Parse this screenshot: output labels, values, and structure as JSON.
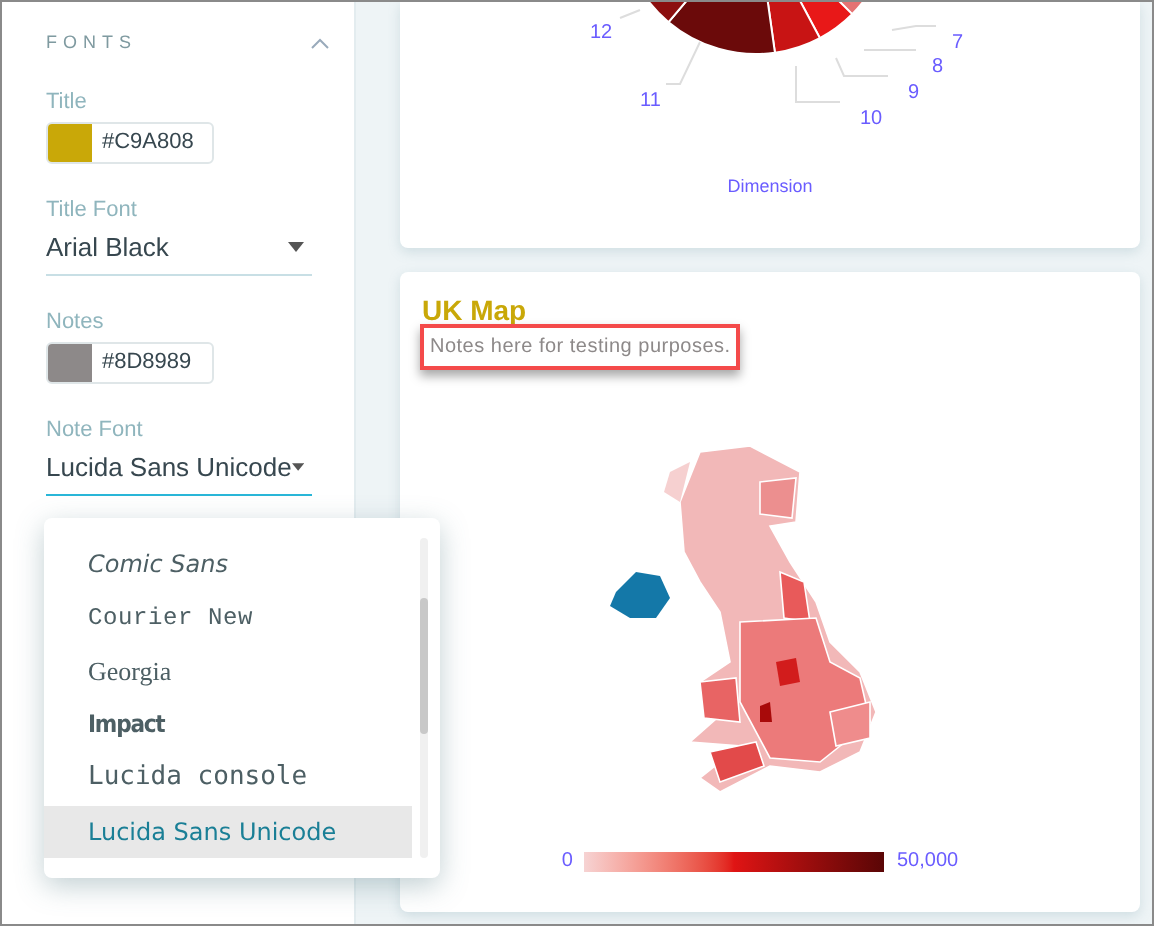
{
  "sidebar": {
    "section": {
      "title": "FONTS",
      "expanded": true
    },
    "fields": [
      {
        "kind": "color",
        "label": "Title",
        "value": "#C9A808",
        "color": "#c9a808"
      },
      {
        "kind": "select",
        "label": "Title Font",
        "value": "Arial Black",
        "focused": false
      },
      {
        "kind": "color",
        "label": "Notes",
        "value": "#8D8989",
        "color": "#8d8989"
      },
      {
        "kind": "select",
        "label": "Note Font",
        "value": "Lucida Sans Unicode",
        "focused": true
      }
    ]
  },
  "dropdown": {
    "options": [
      {
        "label": "Comic Sans",
        "selected": false
      },
      {
        "label": "Courier New",
        "selected": false
      },
      {
        "label": "Georgia",
        "selected": false
      },
      {
        "label": "Impact",
        "selected": false
      },
      {
        "label": "Lucida console",
        "selected": false
      },
      {
        "label": "Lucida Sans Unicode",
        "selected": true
      }
    ]
  },
  "pie_card": {
    "slice_labels": [
      "12",
      "11",
      "10",
      "9",
      "8",
      "7"
    ],
    "axis_label": "Dimension"
  },
  "map_card": {
    "title": "UK Map",
    "notes": "Notes here for testing purposes.",
    "notes_highlighted": true,
    "legend": {
      "min": "0",
      "max": "50,000"
    }
  }
}
